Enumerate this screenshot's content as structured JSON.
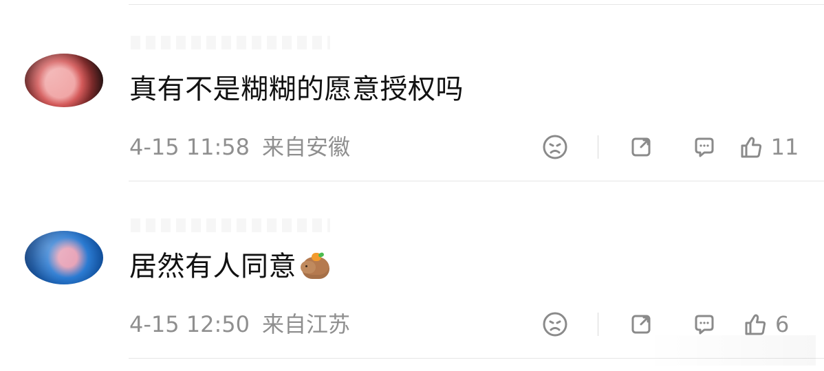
{
  "comments": [
    {
      "text": "真有不是糊糊的愿意授权吗",
      "date_time": "4-15 11:58",
      "location": "来自安徽",
      "likes": "11"
    },
    {
      "text": "居然有人同意",
      "date_time": "4-15 12:50",
      "location": "来自江苏",
      "likes": "6"
    }
  ],
  "icons": {
    "emoji": "capybara-emoji-icon",
    "dislike": "sad-face-icon",
    "share": "share-icon",
    "comment": "comment-icon",
    "like": "thumbs-up-icon"
  }
}
